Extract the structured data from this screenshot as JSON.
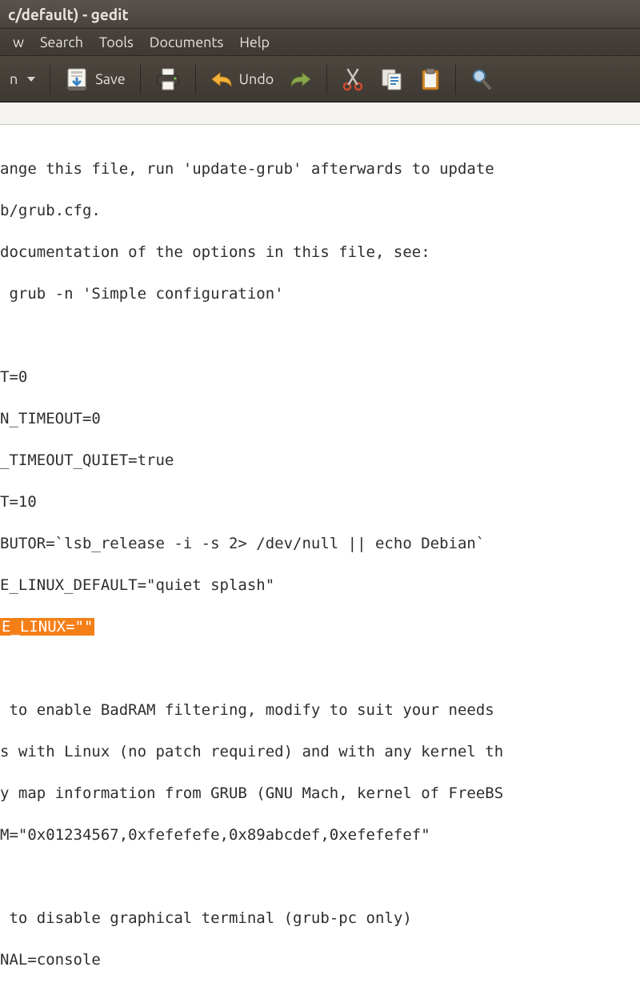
{
  "window": {
    "title": "c/default) - gedit"
  },
  "menu": {
    "items": [
      "w",
      "Search",
      "Tools",
      "Documents",
      "Help"
    ]
  },
  "toolbar": {
    "open_label": "n",
    "save_label": "Save",
    "undo_label": "Undo"
  },
  "editor": {
    "lines": [
      "ange this file, run 'update-grub' afterwards to update",
      "b/grub.cfg.",
      "documentation of the options in this file, see:",
      " grub -n 'Simple configuration'",
      "",
      "T=0",
      "N_TIMEOUT=0",
      "_TIMEOUT_QUIET=true",
      "T=10",
      "BUTOR=`lsb_release -i -s 2> /dev/null || echo Debian`",
      "E_LINUX_DEFAULT=\"quiet splash\"",
      "E_LINUX=\"\"",
      "",
      " to enable BadRAM filtering, modify to suit your needs",
      "s with Linux (no patch required) and with any kernel th",
      "y map information from GRUB (GNU Mach, kernel of FreeBS",
      "M=\"0x01234567,0xfefefefe,0x89abcdef,0xefefefef\"",
      "",
      " to disable graphical terminal (grub-pc only)",
      "NAL=console"
    ],
    "highlighted_line_index": 11
  },
  "colors": {
    "highlight_bg": "#f57f17",
    "toolbar_bg": "#3f3933",
    "accent_orange": "#f39c12",
    "accent_blue": "#3b82c4"
  }
}
